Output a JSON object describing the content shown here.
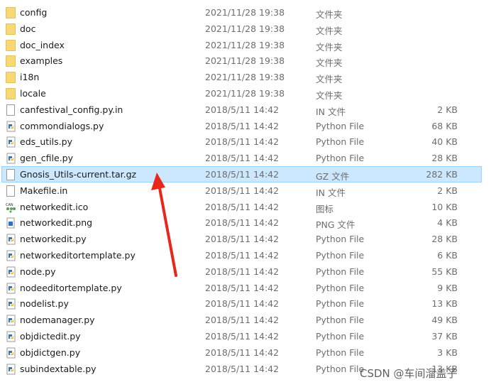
{
  "files": [
    {
      "name": "config",
      "date": "2021/11/28 19:38",
      "type": "文件夹",
      "size": "",
      "icon": "folder-icon"
    },
    {
      "name": "doc",
      "date": "2021/11/28 19:38",
      "type": "文件夹",
      "size": "",
      "icon": "folder-icon"
    },
    {
      "name": "doc_index",
      "date": "2021/11/28 19:38",
      "type": "文件夹",
      "size": "",
      "icon": "folder-icon"
    },
    {
      "name": "examples",
      "date": "2021/11/28 19:38",
      "type": "文件夹",
      "size": "",
      "icon": "folder-icon"
    },
    {
      "name": "i18n",
      "date": "2021/11/28 19:38",
      "type": "文件夹",
      "size": "",
      "icon": "folder-icon"
    },
    {
      "name": "locale",
      "date": "2021/11/28 19:38",
      "type": "文件夹",
      "size": "",
      "icon": "folder-icon"
    },
    {
      "name": "canfestival_config.py.in",
      "date": "2018/5/11 14:42",
      "type": "IN 文件",
      "size": "2 KB",
      "icon": "file-icon"
    },
    {
      "name": "commondialogs.py",
      "date": "2018/5/11 14:42",
      "type": "Python File",
      "size": "68 KB",
      "icon": "python-icon"
    },
    {
      "name": "eds_utils.py",
      "date": "2018/5/11 14:42",
      "type": "Python File",
      "size": "40 KB",
      "icon": "python-icon"
    },
    {
      "name": "gen_cfile.py",
      "date": "2018/5/11 14:42",
      "type": "Python File",
      "size": "28 KB",
      "icon": "python-icon"
    },
    {
      "name": "Gnosis_Utils-current.tar.gz",
      "date": "2018/5/11 14:42",
      "type": "GZ 文件",
      "size": "282 KB",
      "icon": "file-icon",
      "selected": true
    },
    {
      "name": "Makefile.in",
      "date": "2018/5/11 14:42",
      "type": "IN 文件",
      "size": "2 KB",
      "icon": "file-icon"
    },
    {
      "name": "networkedit.ico",
      "date": "2018/5/11 14:42",
      "type": "图标",
      "size": "10 KB",
      "icon": "ico-icon"
    },
    {
      "name": "networkedit.png",
      "date": "2018/5/11 14:42",
      "type": "PNG 文件",
      "size": "4 KB",
      "icon": "image-icon"
    },
    {
      "name": "networkedit.py",
      "date": "2018/5/11 14:42",
      "type": "Python File",
      "size": "28 KB",
      "icon": "python-icon"
    },
    {
      "name": "networkeditortemplate.py",
      "date": "2018/5/11 14:42",
      "type": "Python File",
      "size": "6 KB",
      "icon": "python-icon"
    },
    {
      "name": "node.py",
      "date": "2018/5/11 14:42",
      "type": "Python File",
      "size": "55 KB",
      "icon": "python-icon"
    },
    {
      "name": "nodeeditortemplate.py",
      "date": "2018/5/11 14:42",
      "type": "Python File",
      "size": "9 KB",
      "icon": "python-icon"
    },
    {
      "name": "nodelist.py",
      "date": "2018/5/11 14:42",
      "type": "Python File",
      "size": "13 KB",
      "icon": "python-icon"
    },
    {
      "name": "nodemanager.py",
      "date": "2018/5/11 14:42",
      "type": "Python File",
      "size": "49 KB",
      "icon": "python-icon"
    },
    {
      "name": "objdictedit.py",
      "date": "2018/5/11 14:42",
      "type": "Python File",
      "size": "37 KB",
      "icon": "python-icon"
    },
    {
      "name": "objdictgen.py",
      "date": "2018/5/11 14:42",
      "type": "Python File",
      "size": "3 KB",
      "icon": "python-icon"
    },
    {
      "name": "subindextable.py",
      "date": "2018/5/11 14:42",
      "type": "Python File",
      "size": "13 KB",
      "icon": "python-icon"
    }
  ],
  "watermark": "CSDN @车间溜盖子",
  "colors": {
    "selection": "#cce8ff",
    "arrow": "#e8261c",
    "folder": "#f8d775"
  }
}
